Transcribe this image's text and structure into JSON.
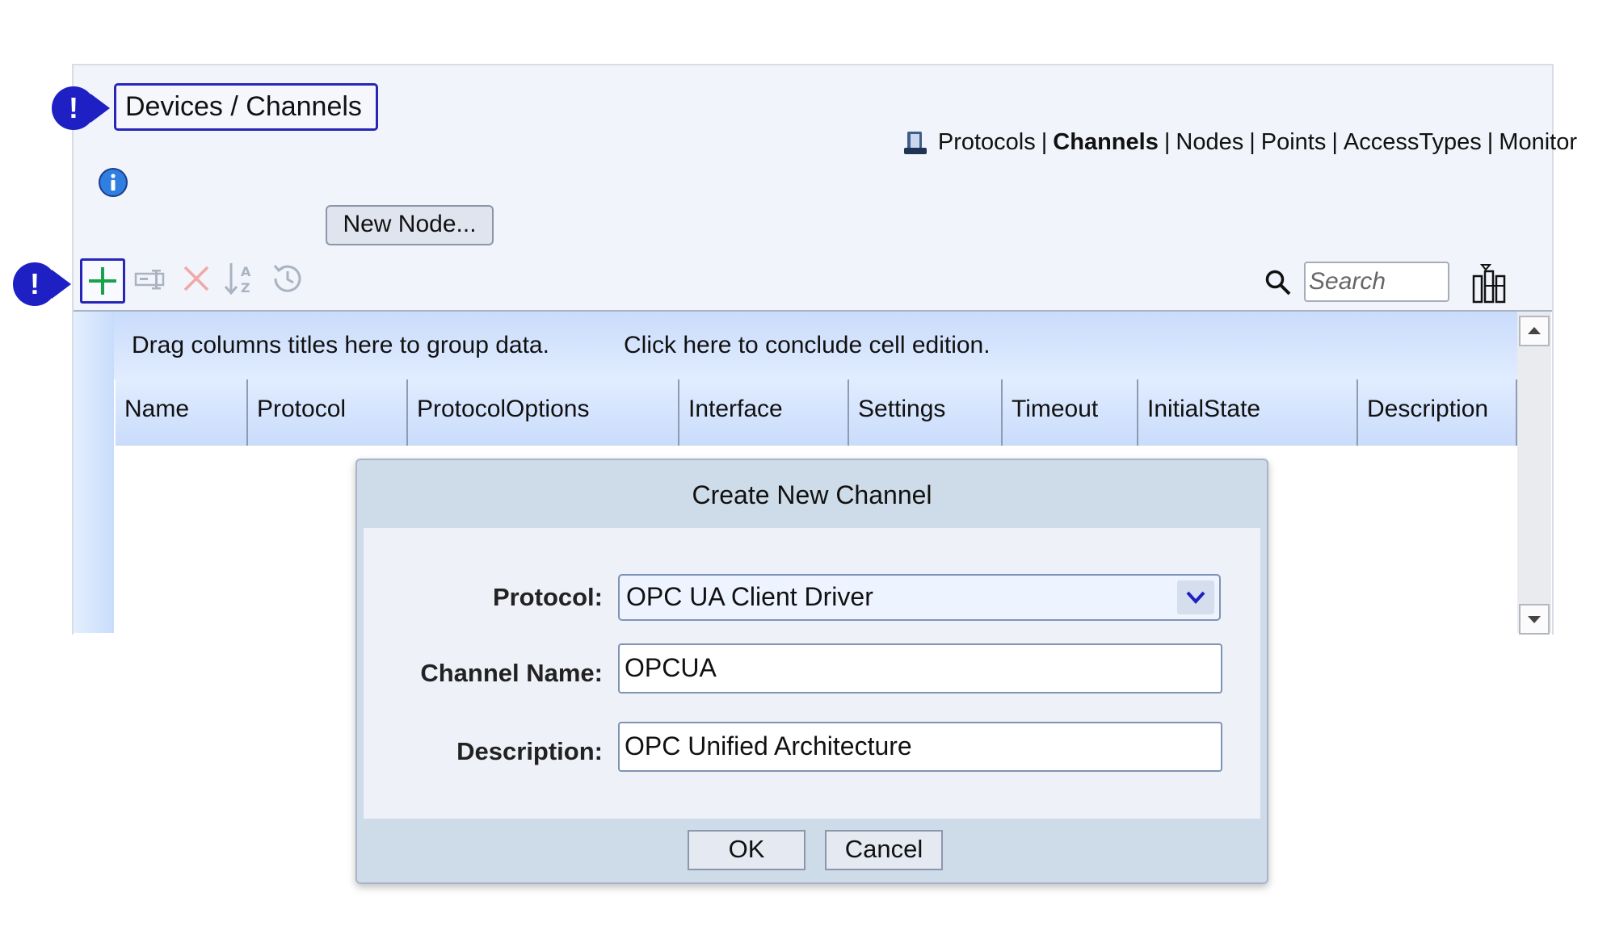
{
  "page": {
    "title": "Devices / Channels",
    "marker_glyph": "!"
  },
  "nav": {
    "items": [
      "Protocols",
      "Channels",
      "Nodes",
      "Points",
      "AccessTypes",
      "Monitor"
    ],
    "active": "Channels",
    "separator": "|"
  },
  "toolbar": {
    "new_node_label": "New Node...",
    "search_placeholder": "Search"
  },
  "grid": {
    "group_hint": "Drag columns titles here to group data.",
    "conclude_hint": "Click here to conclude cell edition.",
    "columns": [
      "Name",
      "Protocol",
      "ProtocolOptions",
      "Interface",
      "Settings",
      "Timeout",
      "InitialState",
      "Description"
    ]
  },
  "dialog": {
    "title": "Create New Channel",
    "protocol_label": "Protocol:",
    "protocol_value": "OPC UA Client Driver",
    "name_label": "Channel Name:",
    "name_value": "OPCUA",
    "description_label": "Description:",
    "description_value": "OPC Unified Architecture",
    "ok_label": "OK",
    "cancel_label": "Cancel"
  },
  "colors": {
    "marker": "#1f20c4",
    "accent_border": "#2626b8",
    "add_icon": "#16a34a",
    "disabled_icon": "#a9b3c2",
    "delete_icon_disabled": "#f0a8a8"
  }
}
